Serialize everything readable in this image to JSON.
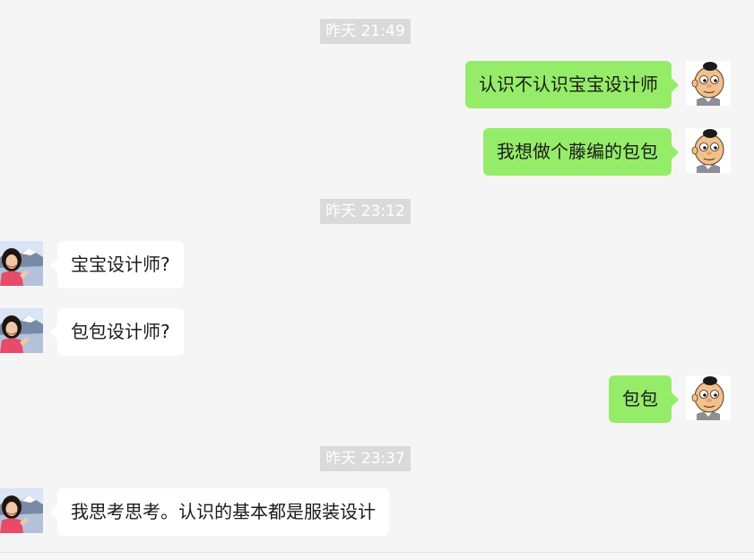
{
  "timestamps": [
    "昨天 21:49",
    "昨天 23:12",
    "昨天 23:37"
  ],
  "messages": [
    {
      "sender": "me",
      "text": "认识不认识宝宝设计师",
      "avatar": "cartoon-boy-avatar"
    },
    {
      "sender": "me",
      "text": "我想做个藤编的包包",
      "avatar": "cartoon-boy-avatar"
    },
    {
      "sender": "contact",
      "text": "宝宝设计师?",
      "avatar": "woman-photo-avatar"
    },
    {
      "sender": "contact",
      "text": "包包设计师?",
      "avatar": "woman-photo-avatar"
    },
    {
      "sender": "me",
      "text": "包包",
      "avatar": "cartoon-boy-avatar"
    },
    {
      "sender": "contact",
      "text": "我思考思考。认识的基本都是服装设计",
      "avatar": "woman-photo-avatar"
    }
  ],
  "colors": {
    "background": "#f5f5f5",
    "outgoing_bubble": "#95ec69",
    "incoming_bubble": "#ffffff",
    "timestamp_bg": "#dadada",
    "timestamp_text": "#ffffff"
  }
}
